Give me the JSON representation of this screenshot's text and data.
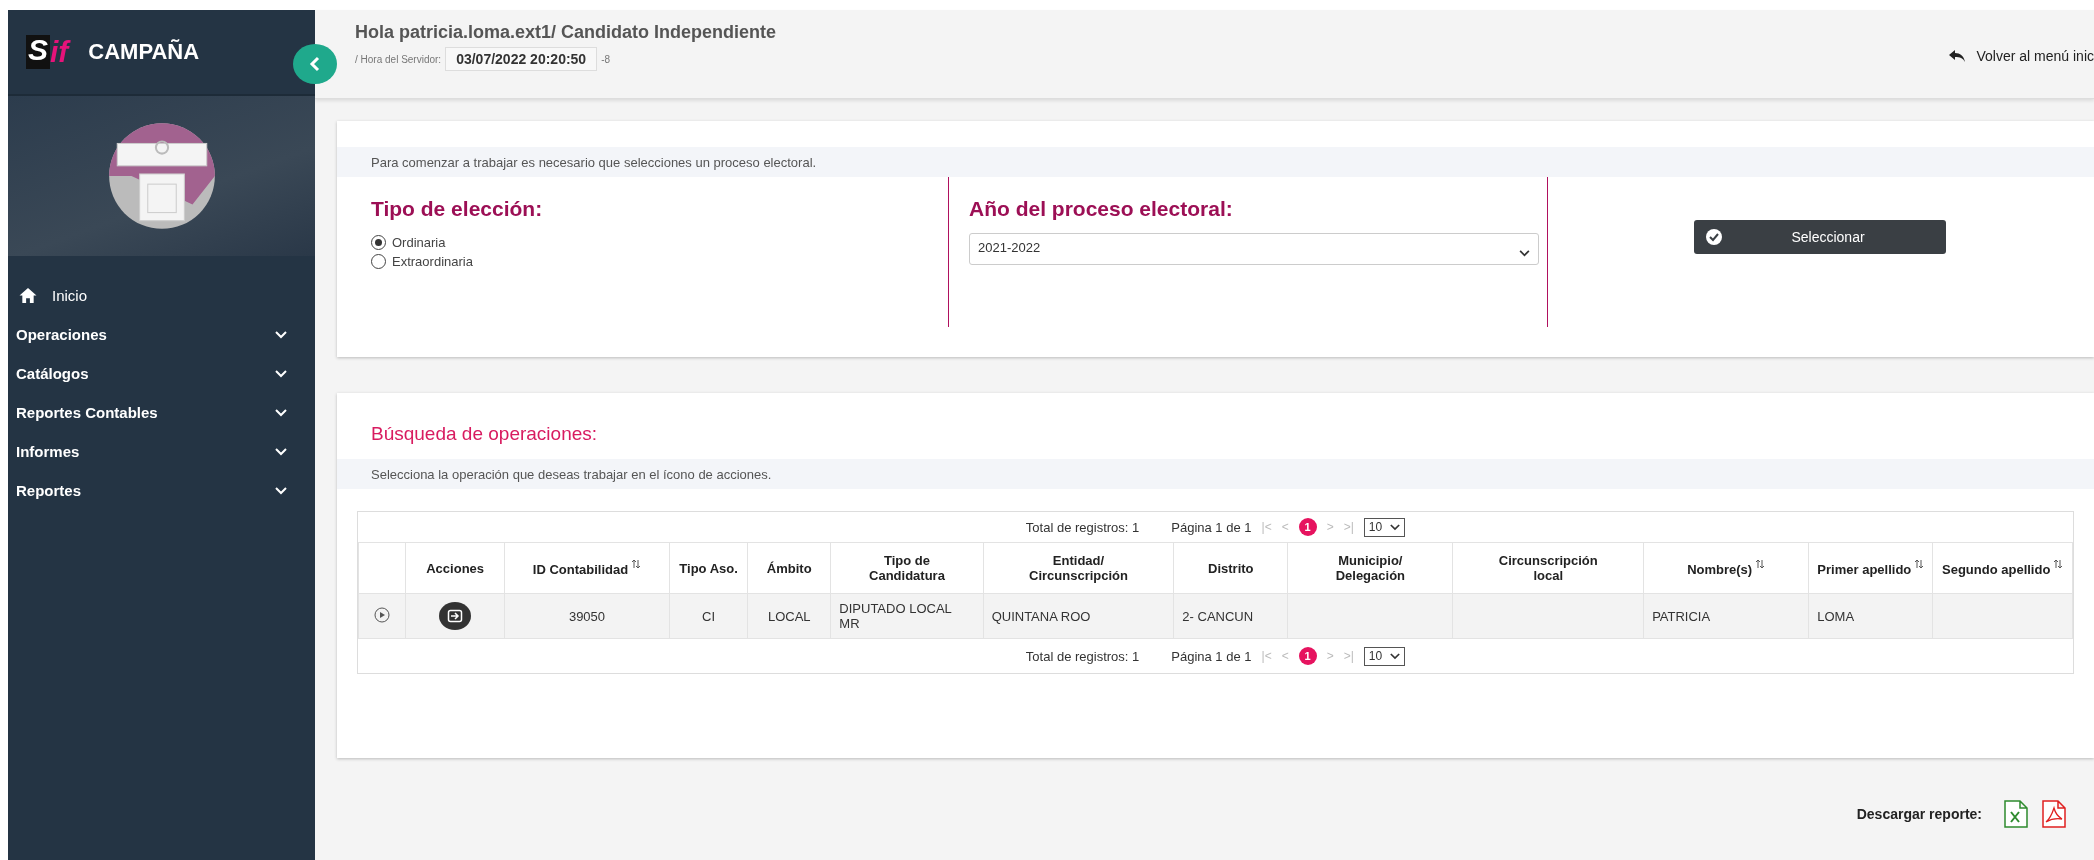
{
  "sidebar": {
    "logo": {
      "mark": "S",
      "suffix": "if"
    },
    "title": "CAMPAÑA",
    "items": [
      {
        "label": "Inicio",
        "kind": "link"
      },
      {
        "label": "Operaciones",
        "kind": "menu",
        "expanded": false
      },
      {
        "label": "Catálogos",
        "kind": "menu",
        "expanded": false
      },
      {
        "label": "Reportes Contables",
        "kind": "menu",
        "expanded": false
      },
      {
        "label": "Informes",
        "kind": "menu",
        "expanded": false
      },
      {
        "label": "Reportes",
        "kind": "menu",
        "expanded": false
      }
    ]
  },
  "header": {
    "greeting": "Hola patricia.loma.ext1/ Candidato Independiente",
    "server_label": "/ Hora del Servidor:",
    "server_time": "03/07/2022 20:20:50",
    "timezone": "-8",
    "back_link": "Volver al menú inic"
  },
  "selection": {
    "notice": "Para comenzar a trabajar es necesario que selecciones un proceso electoral.",
    "election_type": {
      "title": "Tipo de elección:",
      "options": [
        {
          "label": "Ordinaria",
          "selected": true
        },
        {
          "label": "Extraordinaria",
          "selected": false
        }
      ]
    },
    "year": {
      "title": "Año del proceso electoral:",
      "value": "2021-2022"
    },
    "button": "Seleccionar"
  },
  "search": {
    "title": "Búsqueda de operaciones:",
    "notice": "Selecciona la operación que deseas trabajar en el ícono de acciones.",
    "table": {
      "pagination_top": {
        "total": "Total de registros: 1",
        "page": "Página 1 de 1",
        "first": "|<",
        "previous": "<",
        "current": "1",
        "next": ">",
        "last": ">|",
        "page_size": "10"
      },
      "columns": [
        {
          "sortable": false
        },
        {
          "label": "Acciones",
          "sortable": false
        },
        {
          "label": "ID Contabilidad",
          "sortable": true
        },
        {
          "label": "Tipo Aso.",
          "sortable": false
        },
        {
          "label": "Ámbito",
          "sortable": false
        },
        {
          "label": "Tipo de Candidatura",
          "sortable": false
        },
        {
          "label": "Entidad/ Circunscripción",
          "sortable": false
        },
        {
          "label": "Distrito",
          "sortable": false
        },
        {
          "label": "Municipio/ Delegación",
          "sortable": false
        },
        {
          "label": "Circunscripción local",
          "sortable": false
        },
        {
          "label": "Nombre(s)",
          "sortable": true
        },
        {
          "label": "Primer apellido",
          "sortable": true
        },
        {
          "label": "Segundo apellido",
          "sortable": true
        }
      ],
      "rows": [
        {
          "cells": [
            "",
            "",
            "39050",
            "CI",
            "LOCAL",
            "DIPUTADO LOCAL MR",
            "QUINTANA ROO",
            "2- CANCUN",
            "",
            "",
            "PATRICIA",
            "LOMA",
            ""
          ]
        }
      ],
      "pagination_bottom": {
        "total": "Total de registros: 1",
        "page": "Página 1 de 1",
        "first": "|<",
        "previous": "<",
        "current": "1",
        "next": ">",
        "last": ">|",
        "page_size": "10"
      }
    }
  },
  "download": {
    "label": "Descargar reporte:"
  }
}
